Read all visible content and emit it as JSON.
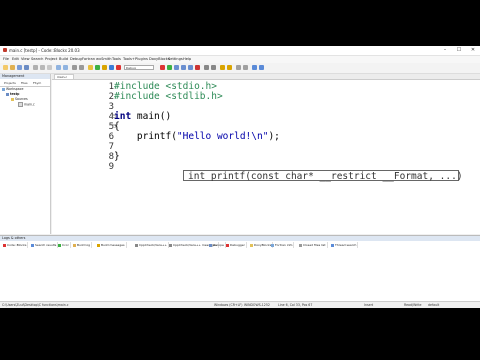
{
  "window": {
    "title": "main.c [testp] - Code::Blocks 20.03",
    "controls": [
      "–",
      "☐",
      "✕"
    ]
  },
  "menu": [
    "File",
    "Edit",
    "View",
    "Search",
    "Project",
    "Build",
    "Debug",
    "Fortran",
    "wxSmith",
    "Tools",
    "Tools+",
    "Plugins",
    "DoxyBlocks",
    "Settings",
    "Help"
  ],
  "toolbar": {
    "target_select": "Debug"
  },
  "management": {
    "title": "Management",
    "tabs": [
      "Projects",
      "Files",
      "FSym"
    ],
    "tree": [
      "Workspace",
      "testp",
      "Sources",
      "main.c"
    ]
  },
  "editor": {
    "tab": "main.c",
    "line_numbers": [
      "1",
      "2",
      "3",
      "4",
      "5",
      "6",
      "7",
      "8",
      "9"
    ],
    "lines": [
      [
        {
          "t": "pp",
          "s": "#include <stdio.h>"
        }
      ],
      [
        {
          "t": "pp",
          "s": "#include <stdlib.h>"
        }
      ],
      [
        {
          "t": "pl",
          "s": ""
        }
      ],
      [
        {
          "t": "kw",
          "s": "int"
        },
        {
          "t": "pl",
          "s": " main()"
        }
      ],
      [
        {
          "t": "pl",
          "s": "{"
        }
      ],
      [
        {
          "t": "pl",
          "s": "    printf("
        },
        {
          "t": "str",
          "s": "\"Hello world!\\n\""
        },
        {
          "t": "pl",
          "s": ");"
        }
      ],
      [
        {
          "t": "pl",
          "s": ""
        }
      ],
      [
        {
          "t": "pl",
          "s": "}"
        }
      ],
      [
        {
          "t": "pl",
          "s": ""
        }
      ]
    ],
    "calltip": "int printf(const char* __restrict __Format, ...)"
  },
  "logs": {
    "title": "Logs & others",
    "tabs": [
      "Code::Blocks",
      "Search results",
      "Cccc",
      "Build log",
      "Build messages",
      "CppCheck/Vera++",
      "CppCheck/Vera++ messages",
      "Cscope",
      "Debugger",
      "DoxyBlocks",
      "Fortran info",
      "Closed files list",
      "Thread search"
    ]
  },
  "status": {
    "path": "C:\\Users\\Zuul\\Desktop\\C functions\\main.c",
    "line_ending": "Windows (CR+LF)",
    "encoding": "WINDOWS-1252",
    "position": "Line 6, Col 33, Pos 67",
    "mode": "Insert",
    "rw": "Read/Write",
    "profile": "default"
  }
}
